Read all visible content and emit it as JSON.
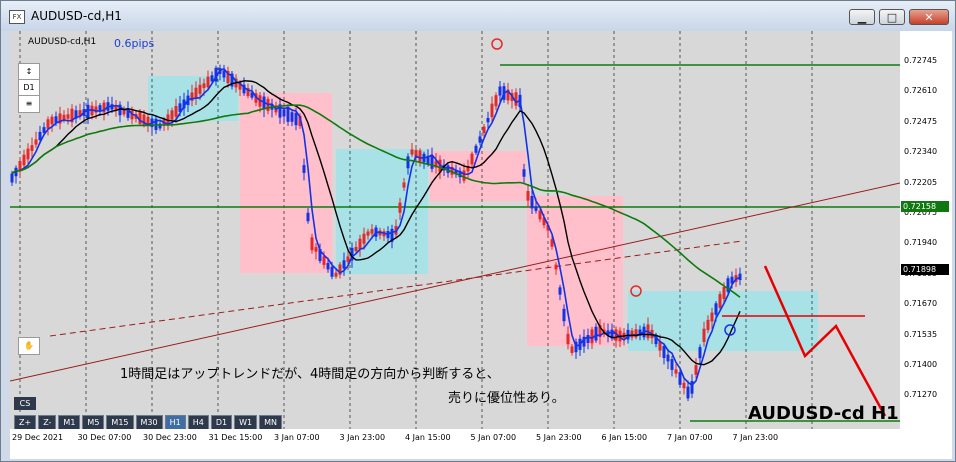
{
  "window": {
    "title": "AUDUSD-cd,H1",
    "icon_label": "FX",
    "controls": {
      "minimize": "▁",
      "maximize": "□",
      "close": "✕"
    }
  },
  "chart": {
    "symbol_label": "AUDUSD-cd,H1",
    "spread_label": "0.6pips",
    "watermark": "AUDUSD-cd H1",
    "note_line1": "1時間足はアップトレンドだが、4時間足の方向から判断すると、",
    "note_line2": "売りに優位性あり。",
    "tools": {
      "arrow": "↕",
      "tf": "D1",
      "menu": "≡"
    },
    "colors": {
      "background": "#d8d8d8",
      "bull_candle": "#1432e6",
      "bear_candle": "#e62828",
      "ma_black": "#000000",
      "ma_green": "#0f7a0f",
      "trendline": "#9b1b1b",
      "sell_zone": "#ffc0cb",
      "buy_zone": "#a8e1e6",
      "forecast": "#e80000"
    }
  },
  "price_axis": {
    "ticks": [
      "0.72745",
      "0.72610",
      "0.72475",
      "0.72340",
      "0.72205",
      "0.72075",
      "0.71940",
      "0.71805",
      "0.71670",
      "0.71535",
      "0.71400",
      "0.71270"
    ],
    "badges": [
      {
        "text": "0.72158",
        "color": "#117711"
      },
      {
        "text": "0.71898",
        "color": "#000000"
      }
    ]
  },
  "time_axis": {
    "ticks": [
      "29 Dec 2021",
      "30 Dec 07:00",
      "30 Dec 23:00",
      "31 Dec 15:00",
      "3 Jan 07:00",
      "3 Jan 23:00",
      "4 Jan 15:00",
      "5 Jan 07:00",
      "5 Jan 23:00",
      "6 Jan 15:00",
      "7 Jan 07:00",
      "7 Jan 23:00"
    ]
  },
  "toolbar": {
    "cs": "CS",
    "timeframes": [
      "Z+",
      "Z-",
      "M1",
      "M5",
      "M15",
      "M30",
      "H1",
      "H4",
      "D1",
      "W1",
      "MN"
    ],
    "active_timeframe": "H1"
  }
}
